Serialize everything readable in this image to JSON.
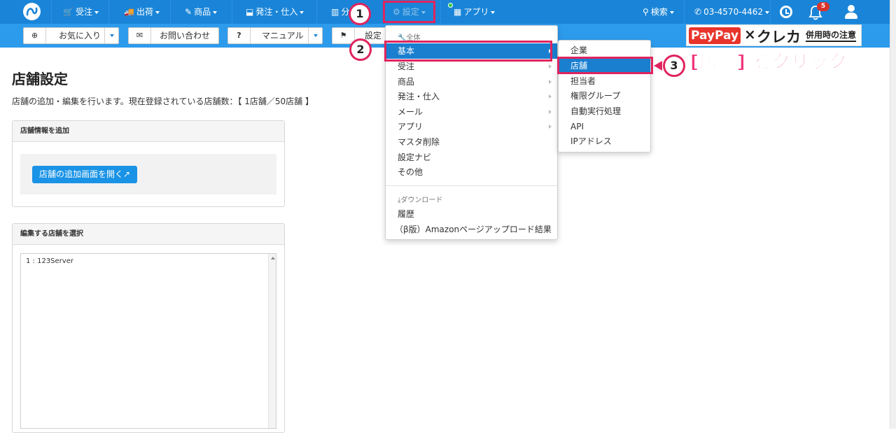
{
  "nav": {
    "items": [
      {
        "icon": "cart-icon",
        "glyph": "🛒",
        "label": "受注"
      },
      {
        "icon": "truck-icon",
        "glyph": "🚚",
        "label": "出荷"
      },
      {
        "icon": "pencil-icon",
        "glyph": "✎",
        "label": "商品"
      },
      {
        "icon": "inbox-icon",
        "glyph": "⬓",
        "label": "発注・仕入"
      },
      {
        "icon": "chart-icon",
        "glyph": "▥",
        "label": "分"
      },
      {
        "icon": "gear-icon",
        "glyph": "⚙",
        "label": "設定"
      },
      {
        "icon": "apps-icon",
        "glyph": "▦",
        "label": "アプリ"
      }
    ],
    "search": {
      "icon": "search-icon",
      "glyph": "⚲",
      "label": "検索"
    },
    "phone": {
      "icon": "phone-icon",
      "glyph": "✆",
      "label": "03-4570-4462"
    },
    "notifications_count": "5"
  },
  "subbar": {
    "favorites": {
      "icon": "plus-circle-icon",
      "glyph": "⊕",
      "label": "お気に入り"
    },
    "contact": {
      "icon": "envelope-icon",
      "glyph": "✉",
      "label": "お問い合わせ"
    },
    "manual": {
      "icon": "question-icon",
      "glyph": "?",
      "label": "マニュアル"
    },
    "flag": {
      "icon": "flag-icon",
      "glyph": "⚑",
      "label": "設定ナ"
    }
  },
  "banner": {
    "logo": "PayPay",
    "times": "×",
    "brand": "クレカ",
    "note": "併用時の注意"
  },
  "page": {
    "title": "店舗設定",
    "description": "店舗の追加・編集を行います。現在登録されている店舗数：【 1店舗／50店舗 】",
    "add_panel_title": "店舗情報を追加",
    "add_button": "店舗の追加画面を開く↗",
    "select_panel_title": "編集する店舗を選択",
    "stores": [
      "1 : 123Server"
    ]
  },
  "settings_menu": {
    "section_all": "全体",
    "items": [
      "基本",
      "受注",
      "商品",
      "発注・仕入",
      "メール",
      "アプリ",
      "マスタ削除",
      "設定ナビ",
      "その他"
    ],
    "section_download": "ダウンロード",
    "download_items": [
      "履歴",
      "（β版）Amazonページアップロード結果"
    ]
  },
  "basic_submenu": {
    "items": [
      "企業",
      "店舗",
      "担当者",
      "権限グループ",
      "自動実行処理",
      "API",
      "IPアドレス"
    ]
  },
  "annotations": {
    "step1": "1",
    "step2": "2",
    "step3": "3",
    "instruction": "[店舗] をクリック"
  },
  "colors": {
    "nav": "#1a85d8",
    "subbar": "#2d9bec",
    "highlight": "#1a7fcf",
    "annotation": "#e0245e"
  }
}
